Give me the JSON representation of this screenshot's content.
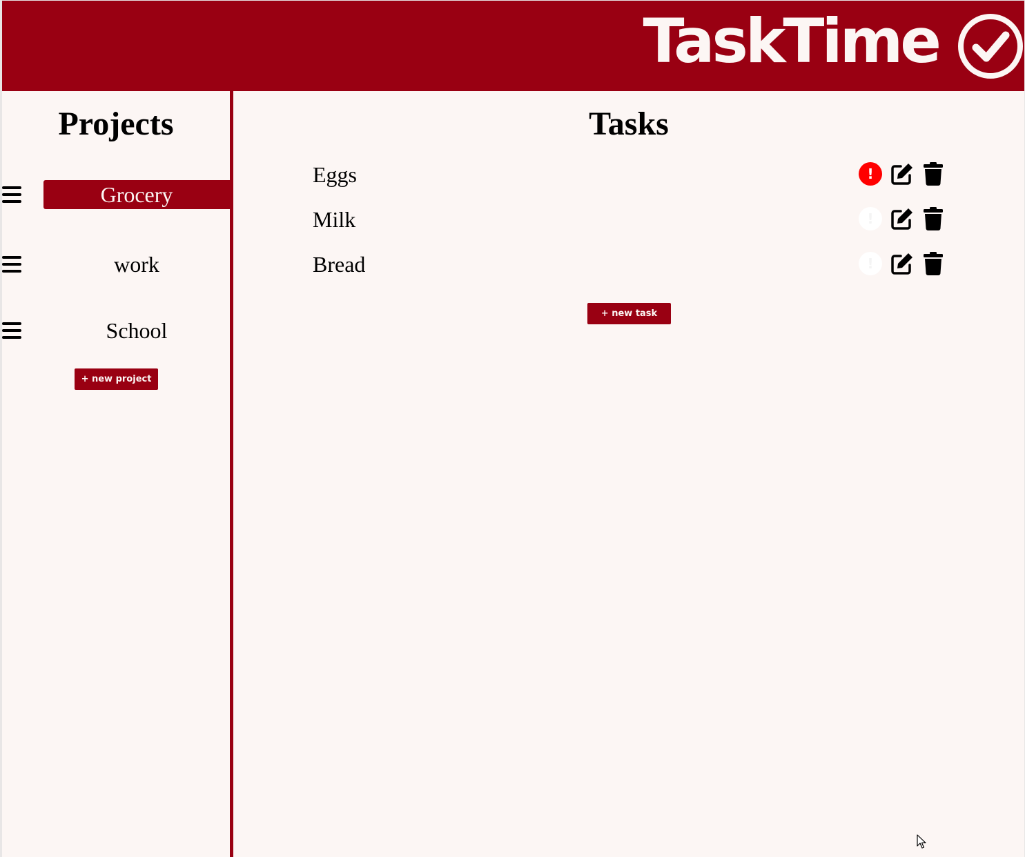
{
  "app": {
    "title": "TaskTime",
    "logo_icon": "check-circle-icon",
    "brand_color": "#990012",
    "background_color": "#fcf6f4"
  },
  "sidebar": {
    "title": "Projects",
    "items": [
      {
        "label": "Grocery",
        "active": true,
        "handle_icon": "drag-handle-icon"
      },
      {
        "label": "work",
        "active": false,
        "handle_icon": "drag-handle-icon"
      },
      {
        "label": "School",
        "active": false,
        "handle_icon": "drag-handle-icon"
      }
    ],
    "new_project_label": "+ new project"
  },
  "main": {
    "title": "Tasks",
    "tasks": [
      {
        "name": "Eggs",
        "priority": true,
        "priority_glyph": "!"
      },
      {
        "name": "Milk",
        "priority": false,
        "priority_glyph": "!"
      },
      {
        "name": "Bread",
        "priority": false,
        "priority_glyph": "!"
      }
    ],
    "task_icons": [
      "priority-icon",
      "edit-icon",
      "trash-icon"
    ],
    "priority_color": "#ff0000",
    "new_task_label": "+ new task"
  }
}
